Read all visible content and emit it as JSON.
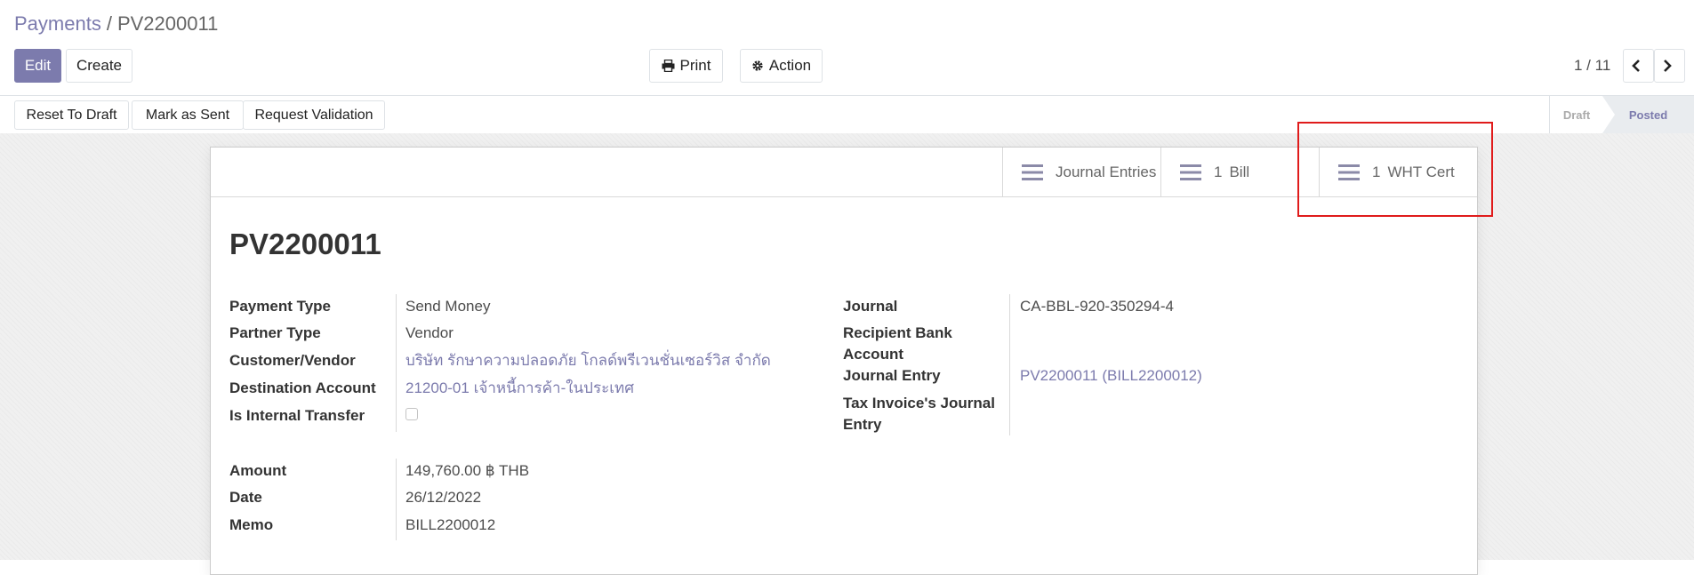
{
  "breadcrumb": {
    "parent": "Payments",
    "separator": "/",
    "current": "PV2200011"
  },
  "toolbar": {
    "edit": "Edit",
    "create": "Create",
    "print": "Print",
    "action": "Action"
  },
  "pager": {
    "value": "1 / 11"
  },
  "statusbar": {
    "buttons": [
      "Reset To Draft",
      "Mark as Sent",
      "Request Validation"
    ],
    "stages": {
      "draft": "Draft",
      "posted": "Posted",
      "active": "Posted"
    }
  },
  "smart_buttons": {
    "journal_entries": {
      "label": "Journal Entries"
    },
    "bill": {
      "count": "1",
      "label": "Bill"
    },
    "wht": {
      "count": "1",
      "label": "WHT Cert"
    }
  },
  "record": {
    "name": "PV2200011"
  },
  "left_fields": {
    "payment_type": {
      "label": "Payment Type",
      "value": "Send Money"
    },
    "partner_type": {
      "label": "Partner Type",
      "value": "Vendor"
    },
    "customer_vendor": {
      "label": "Customer/Vendor",
      "value": "บริษัท รักษาความปลอดภัย โกลด์พรีเวนชั่นเซอร์วิส จำกัด"
    },
    "destination_account": {
      "label": "Destination Account",
      "value": "21200-01 เจ้าหนี้การค้า-ในประเทศ"
    },
    "internal_transfer": {
      "label": "Is Internal Transfer",
      "checked": false
    }
  },
  "right_fields": {
    "journal": {
      "label": "Journal",
      "value": "CA-BBL-920-350294-4"
    },
    "recipient_bank": {
      "label_line1": "Recipient Bank",
      "label_line2": "Account",
      "value": ""
    },
    "journal_entry": {
      "label": "Journal Entry",
      "value": "PV2200011 (BILL2200012)"
    },
    "tax_invoice": {
      "label_line1": "Tax Invoice's Journal",
      "label_line2": "Entry",
      "value": ""
    }
  },
  "amount_fields": {
    "amount": {
      "label": "Amount",
      "value": "149,760.00 ฿ THB"
    },
    "date": {
      "label": "Date",
      "value": "26/12/2022"
    },
    "memo": {
      "label": "Memo",
      "value": "BILL2200012"
    }
  },
  "colors": {
    "primary": "#7c7bad",
    "highlight": "#e01b1b"
  }
}
